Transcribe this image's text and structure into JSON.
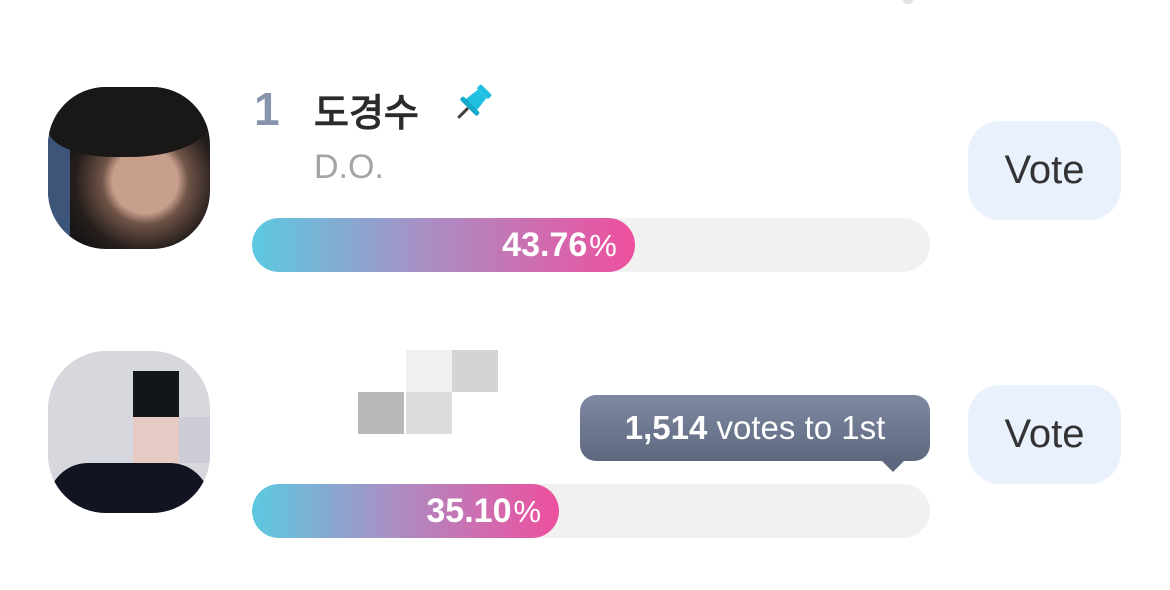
{
  "candidates": [
    {
      "rank": "1",
      "name": "도경수",
      "sub_name": "D.O.",
      "pinned": true,
      "percent": "43.76",
      "percent_value": 43.76,
      "vote_label": "Vote",
      "icon": "pin-icon"
    },
    {
      "percent": "35.10",
      "percent_value": 35.1,
      "vote_label": "Vote",
      "tooltip": {
        "votes": "1,514",
        "text": "votes to 1st"
      }
    }
  ],
  "percent_symbol": "%",
  "colors": {
    "bar_start": "#5bc9e0",
    "bar_end": "#ee4f9e",
    "rank": "#8894ad",
    "vote_bg": "#e9f1fd",
    "tooltip_bg": "#6b768d",
    "pin": "#1fc0e0"
  }
}
